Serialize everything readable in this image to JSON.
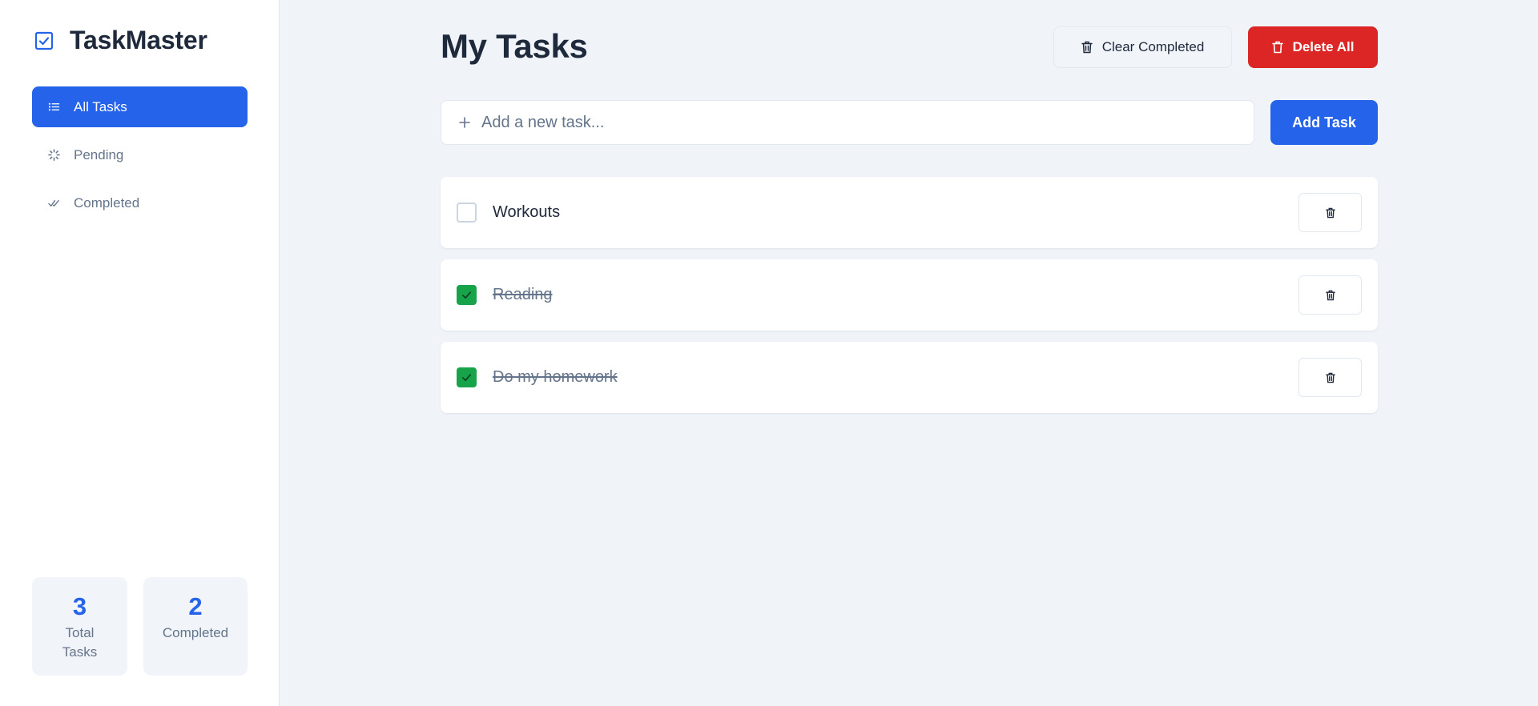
{
  "app": {
    "title": "TaskMaster",
    "icon": "checkbox-icon",
    "accent": "#2563eb"
  },
  "sidebar": {
    "items": [
      {
        "label": "All Tasks",
        "icon": "list-icon",
        "active": true
      },
      {
        "label": "Pending",
        "icon": "spinner-icon",
        "active": false
      },
      {
        "label": "Completed",
        "icon": "double-check-icon",
        "active": false
      }
    ],
    "stats": [
      {
        "value": "3",
        "label": "Total Tasks"
      },
      {
        "value": "2",
        "label": "Completed"
      }
    ]
  },
  "header": {
    "title": "My Tasks",
    "clear_label": "Clear Completed",
    "delete_all_label": "Delete All",
    "delete_color": "#dc2626"
  },
  "composer": {
    "placeholder": "Add a new task...",
    "value": "",
    "add_label": "Add Task"
  },
  "tasks": [
    {
      "text": "Workouts",
      "completed": false
    },
    {
      "text": "Reading",
      "completed": true
    },
    {
      "text": "Do my homework",
      "completed": true
    }
  ],
  "colors": {
    "completed_check": "#16a34a",
    "background": "#f0f4f9"
  }
}
